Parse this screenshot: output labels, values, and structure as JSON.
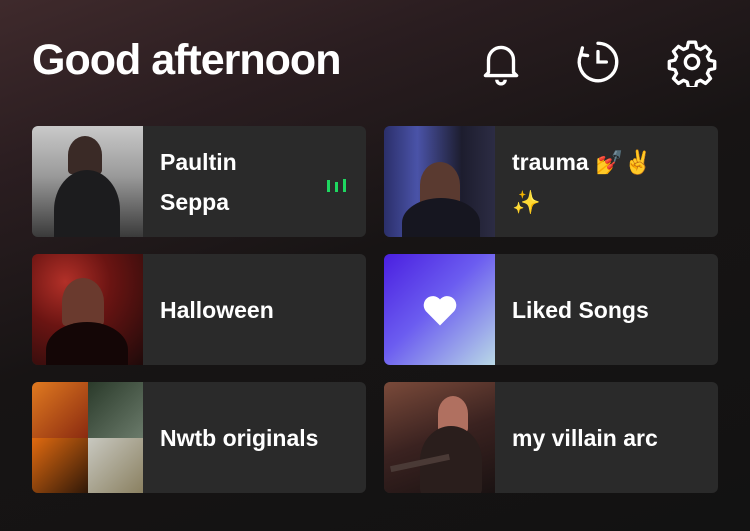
{
  "header": {
    "greeting": "Good afternoon",
    "icons": [
      "bell-icon",
      "history-icon",
      "gear-icon"
    ]
  },
  "tiles": [
    {
      "title_line1": "Paultin",
      "title_line2": "Seppa",
      "now_playing": true
    },
    {
      "title_line1": "trauma 💅✌️",
      "title_line2": "✨"
    },
    {
      "title": "Halloween"
    },
    {
      "title": "Liked Songs"
    },
    {
      "title": "Nwtb originals"
    },
    {
      "title": "my villain arc"
    }
  ],
  "colors": {
    "accent_green": "#1ed760",
    "tile_bg": "#2a2a2a",
    "page_bg": "#121212"
  }
}
